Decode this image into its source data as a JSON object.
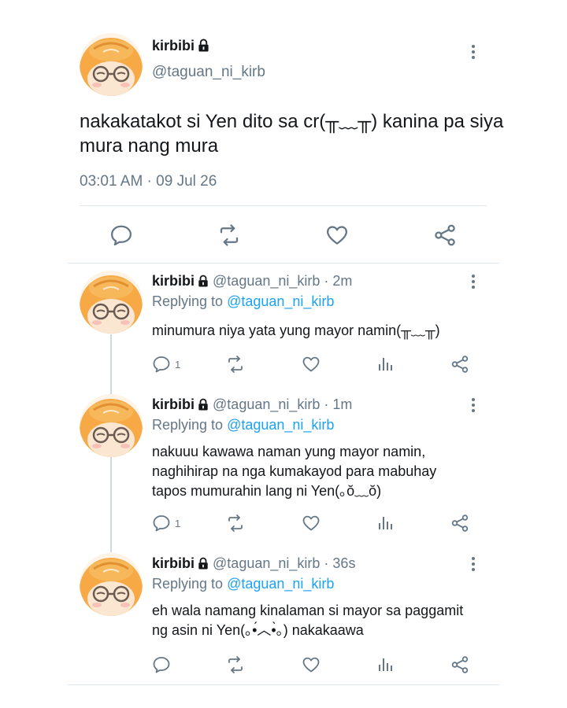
{
  "main_tweet": {
    "display_name": "kirbibi",
    "handle": "@taguan_ni_kirb",
    "text": "nakakatakot si Yen dito sa cr(╥﹏╥) kanina pa siya mura nang mura",
    "timestamp": "03:01 AM · 09 Jul 26"
  },
  "replies": [
    {
      "display_name": "kirbibi",
      "handle": "@taguan_ni_kirb",
      "time": "· 2m",
      "replying_prefix": "Replying to",
      "replying_to": "@taguan_ni_kirb",
      "text": "minumura niya yata yung mayor namin(╥﹏╥)",
      "reply_count": "1"
    },
    {
      "display_name": "kirbibi",
      "handle": "@taguan_ni_kirb",
      "time": "· 1m",
      "replying_prefix": "Replying to",
      "replying_to": "@taguan_ni_kirb",
      "text": "nakuuu kawawa naman yung mayor namin, naghihirap na nga kumakayod para mabuhay tapos mumurahin lang ni Yen(｡ŏ﹏ŏ)",
      "reply_count": "1"
    },
    {
      "display_name": "kirbibi",
      "handle": "@taguan_ni_kirb",
      "time": "· 36s",
      "replying_prefix": "Replying to",
      "replying_to": "@taguan_ni_kirb",
      "text": "eh wala namang kinalaman si mayor sa paggamit ng asin ni Yen(｡•́︿•̀｡) nakakaawa",
      "reply_count": ""
    }
  ],
  "icons": {
    "reply": "reply-icon",
    "retweet": "retweet-icon",
    "like": "like-icon",
    "analytics": "analytics-icon",
    "share": "share-icon",
    "more": "more-icon",
    "lock": "lock-icon"
  },
  "colors": {
    "text": "#14171a",
    "secondary": "#657786",
    "link": "#1da1f2",
    "divider": "#e1e8ed",
    "avatar_bg": "#f2a646"
  }
}
